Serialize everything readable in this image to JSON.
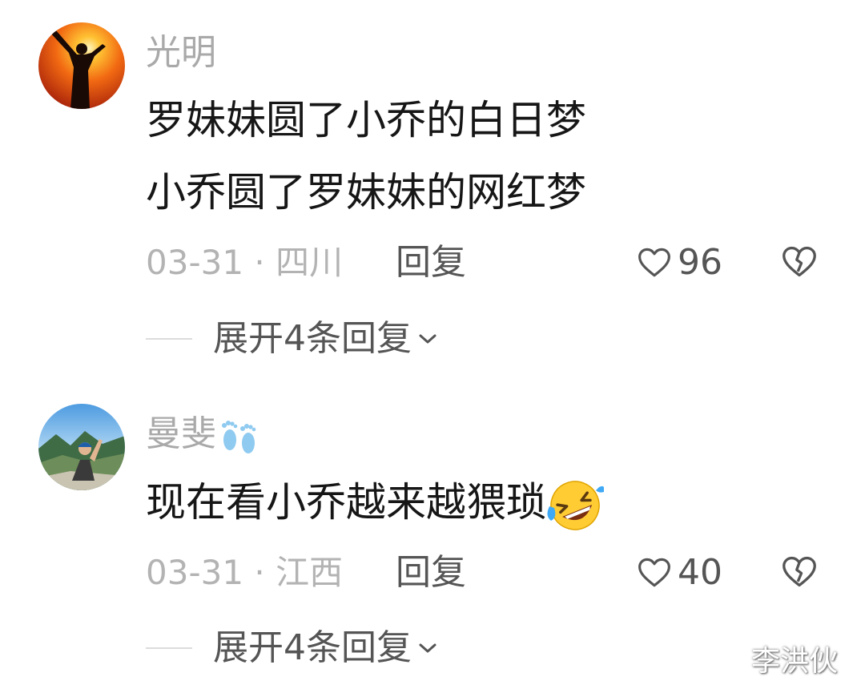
{
  "comments": [
    {
      "avatar_icon": "sunset-silhouette-avatar",
      "username": "光明",
      "lines": [
        "罗妹妹圆了小乔的白日梦",
        "小乔圆了罗妹妹的网红梦"
      ],
      "date": "03-31",
      "separator": "·",
      "location": "四川",
      "reply_label": "回复",
      "like_icon": "heart-outline-icon",
      "likes": "96",
      "dislike_icon": "broken-heart-icon",
      "expand_label": "展开4条回复",
      "expand_icon": "chevron-down-icon"
    },
    {
      "avatar_icon": "mountain-landscape-avatar",
      "username": "曼斐",
      "username_emoji": "footprints-emoji",
      "lines": [
        "现在看小乔越来越猥琐"
      ],
      "line_emoji": "rolling-laughing-emoji",
      "date": "03-31",
      "separator": "·",
      "location": "江西",
      "reply_label": "回复",
      "like_icon": "heart-outline-icon",
      "likes": "40",
      "dislike_icon": "broken-heart-icon",
      "expand_label": "展开4条回复",
      "expand_icon": "chevron-down-icon"
    }
  ],
  "watermark": "李洪伙",
  "colors": {
    "username": "#a9a9a9",
    "body_text": "#161616",
    "meta_text": "#b3b3b3",
    "action_text": "#555555"
  }
}
